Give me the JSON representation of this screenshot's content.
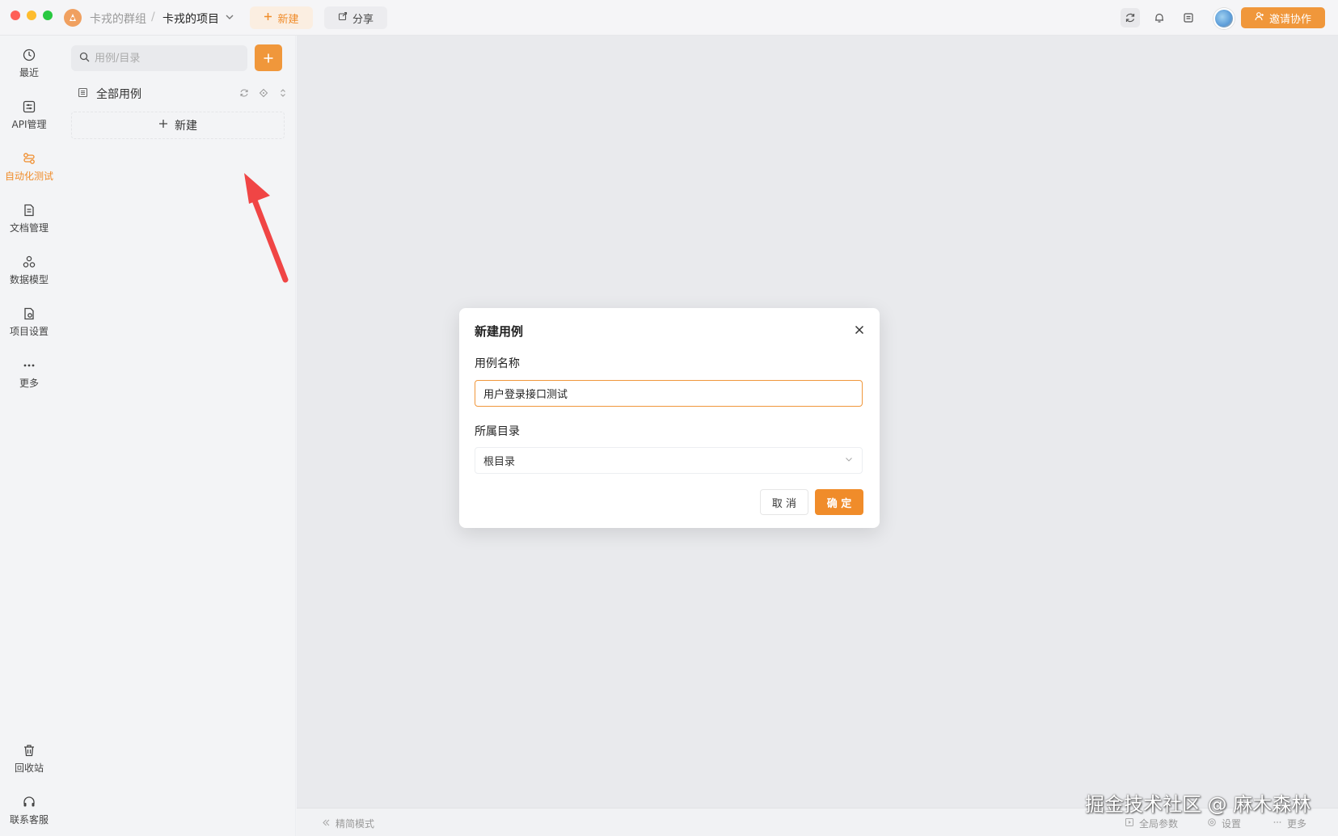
{
  "topbar": {
    "group": "卡戎的群组",
    "separator": "/",
    "project": "卡戎的项目",
    "new_label": "新建",
    "share_label": "分享",
    "invite_label": "邀请协作"
  },
  "nav": {
    "items": [
      {
        "label": "最近",
        "icon": "history-icon"
      },
      {
        "label": "API管理",
        "icon": "api-icon"
      },
      {
        "label": "自动化测试",
        "icon": "automation-icon"
      },
      {
        "label": "文档管理",
        "icon": "document-icon"
      },
      {
        "label": "数据模型",
        "icon": "data-model-icon"
      },
      {
        "label": "项目设置",
        "icon": "project-settings-icon"
      },
      {
        "label": "更多",
        "icon": "more-icon"
      }
    ],
    "bottom": [
      {
        "label": "回收站",
        "icon": "trash-icon"
      },
      {
        "label": "联系客服",
        "icon": "headset-icon"
      }
    ],
    "active_color": "#f08c2a"
  },
  "panel": {
    "search_placeholder": "用例/目录",
    "tree_title": "全部用例",
    "new_label": "新建"
  },
  "bottom_bar": {
    "simple_mode": "精简模式",
    "global_params": "全局参数",
    "settings": "设置",
    "more": "更多"
  },
  "dialog": {
    "title": "新建用例",
    "name_label": "用例名称",
    "name_value": "用户登录接口测试",
    "dir_label": "所属目录",
    "dir_value": "根目录",
    "cancel_label": "取 消",
    "ok_label": "确 定"
  },
  "watermark": "掘金技术社区 @ 麻木森林",
  "colors": {
    "accent": "#f08c2a",
    "arrow": "#f04545"
  }
}
